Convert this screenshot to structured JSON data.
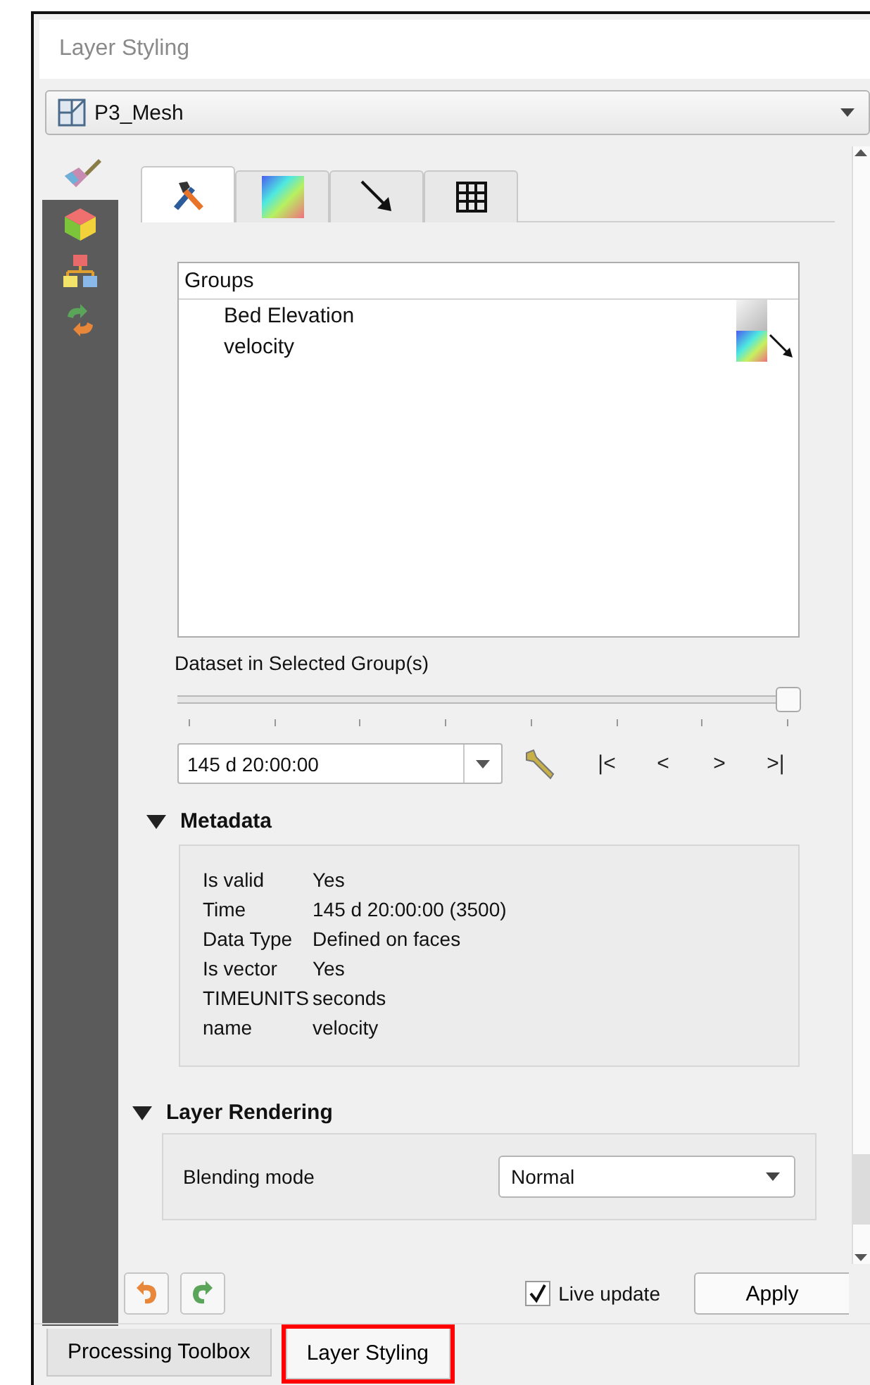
{
  "window": {
    "title": "Layer Styling"
  },
  "layer_selector": {
    "value": "P3_Mesh"
  },
  "sidebar": {
    "items": [
      {
        "kind": "style",
        "selected": true
      },
      {
        "kind": "cube",
        "selected": false
      },
      {
        "kind": "hierarchy",
        "selected": false
      },
      {
        "kind": "history",
        "selected": false
      }
    ]
  },
  "tabs": [
    {
      "kind": "source",
      "selected": true
    },
    {
      "kind": "contours",
      "selected": false
    },
    {
      "kind": "vectors",
      "selected": false
    },
    {
      "kind": "mesh",
      "selected": false
    }
  ],
  "groups": {
    "header": "Groups",
    "items": [
      {
        "label": "Bed Elevation",
        "scalar_active": false,
        "vector": false
      },
      {
        "label": "velocity",
        "scalar_active": true,
        "vector": true
      }
    ]
  },
  "dataset": {
    "label": "Dataset in Selected Group(s)",
    "slider": {
      "level": 1
    },
    "time_value": "145 d 20:00:00",
    "nav": [
      "|<",
      "<",
      ">",
      ">|"
    ]
  },
  "metadata": {
    "title": "Metadata",
    "expanded": true,
    "rows": [
      {
        "key": "Is valid",
        "value": "Yes"
      },
      {
        "key": "Time",
        "value": "145 d 20:00:00 (3500)"
      },
      {
        "key": "Data Type",
        "value": "Defined on faces"
      },
      {
        "key": "Is vector",
        "value": "Yes"
      },
      {
        "key": "TIMEUNITS",
        "value": "seconds"
      },
      {
        "key": "name",
        "value": "velocity"
      }
    ]
  },
  "layer_rendering": {
    "title": "Layer Rendering",
    "expanded": true,
    "blending_label": "Blending mode",
    "blending_value": "Normal"
  },
  "footer": {
    "live_update": {
      "label": "Live update",
      "checked": true
    },
    "apply": "Apply"
  },
  "dock_tabs": [
    {
      "label": "Processing Toolbox",
      "selected": false,
      "highlighted": false
    },
    {
      "label": "Layer Styling",
      "selected": true,
      "highlighted": true
    }
  ]
}
